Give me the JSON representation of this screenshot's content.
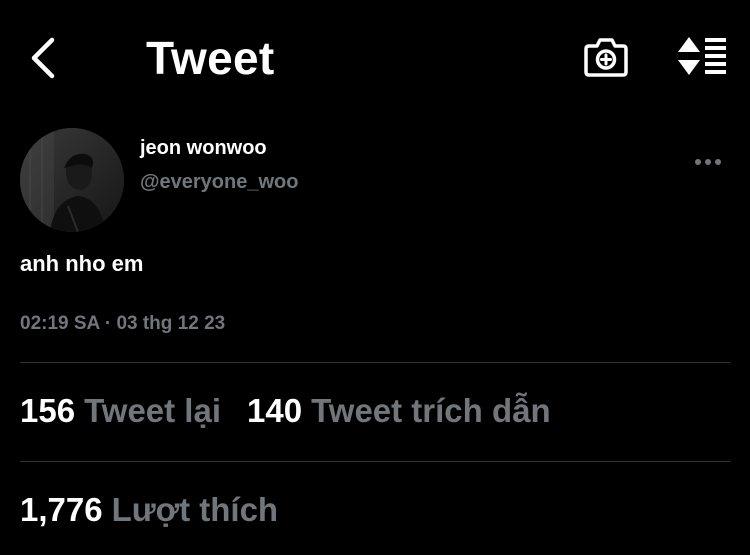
{
  "header": {
    "title": "Tweet",
    "back_icon": "chevron-left-icon",
    "camera_icon": "add-photo-icon",
    "sort_icon": "sort-thread-icon"
  },
  "author": {
    "display_name": "jeon wonwoo",
    "handle": "@everyone_woo",
    "avatar": "avatar-photo",
    "more_icon": "more-horizontal-icon"
  },
  "tweet": {
    "text": "anh nho em",
    "timestamp": "02:19 SA · 03 thg 12 23"
  },
  "stats": {
    "retweets": {
      "count": "156",
      "label": "Tweet lại"
    },
    "quotes": {
      "count": "140",
      "label": "Tweet trích dẫn"
    },
    "likes": {
      "count": "1,776",
      "label": "Lượt thích"
    }
  },
  "colors": {
    "background": "#000000",
    "primary_text": "#ffffff",
    "secondary_text": "#71767b",
    "divider": "#2f3336"
  }
}
